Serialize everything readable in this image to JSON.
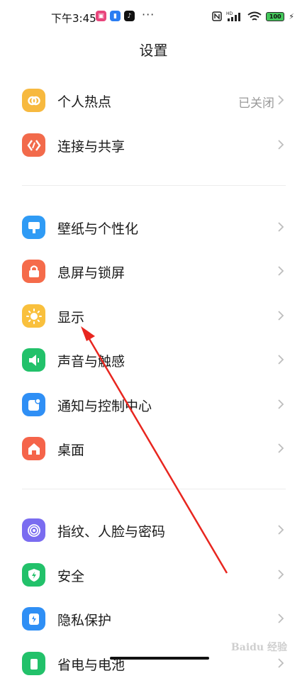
{
  "status_bar": {
    "time": "下午3:45",
    "network_badge": "HD",
    "battery": "100"
  },
  "header": {
    "title": "设置"
  },
  "groups": [
    {
      "items": [
        {
          "label": "个人热点",
          "value": "已关闭",
          "icon": "hotspot-icon",
          "color": "#f7b93f"
        },
        {
          "label": "连接与共享",
          "icon": "connection-share-icon",
          "color": "#f26a4b"
        }
      ]
    },
    {
      "items": [
        {
          "label": "壁纸与个性化",
          "icon": "wallpaper-icon",
          "color": "#2f9bf5"
        },
        {
          "label": "息屏与锁屏",
          "icon": "lock-icon",
          "color": "#f56b4a"
        },
        {
          "label": "显示",
          "icon": "sun-icon",
          "color": "#f9c03d"
        },
        {
          "label": "声音与触感",
          "icon": "speaker-icon",
          "color": "#22c16a"
        },
        {
          "label": "通知与控制中心",
          "icon": "notification-icon",
          "color": "#2f8ff5"
        },
        {
          "label": "桌面",
          "icon": "home-icon",
          "color": "#f5644a"
        }
      ]
    },
    {
      "items": [
        {
          "label": "指纹、人脸与密码",
          "icon": "fingerprint-icon",
          "color": "#7a6cf0"
        },
        {
          "label": "安全",
          "icon": "shield-icon",
          "color": "#22c16a"
        },
        {
          "label": "隐私保护",
          "icon": "privacy-icon",
          "color": "#2f8ff5"
        },
        {
          "label": "省电与电池",
          "icon": "battery-saver-icon",
          "color": "#22c16a"
        }
      ]
    }
  ],
  "watermark": "Baidu 经验"
}
